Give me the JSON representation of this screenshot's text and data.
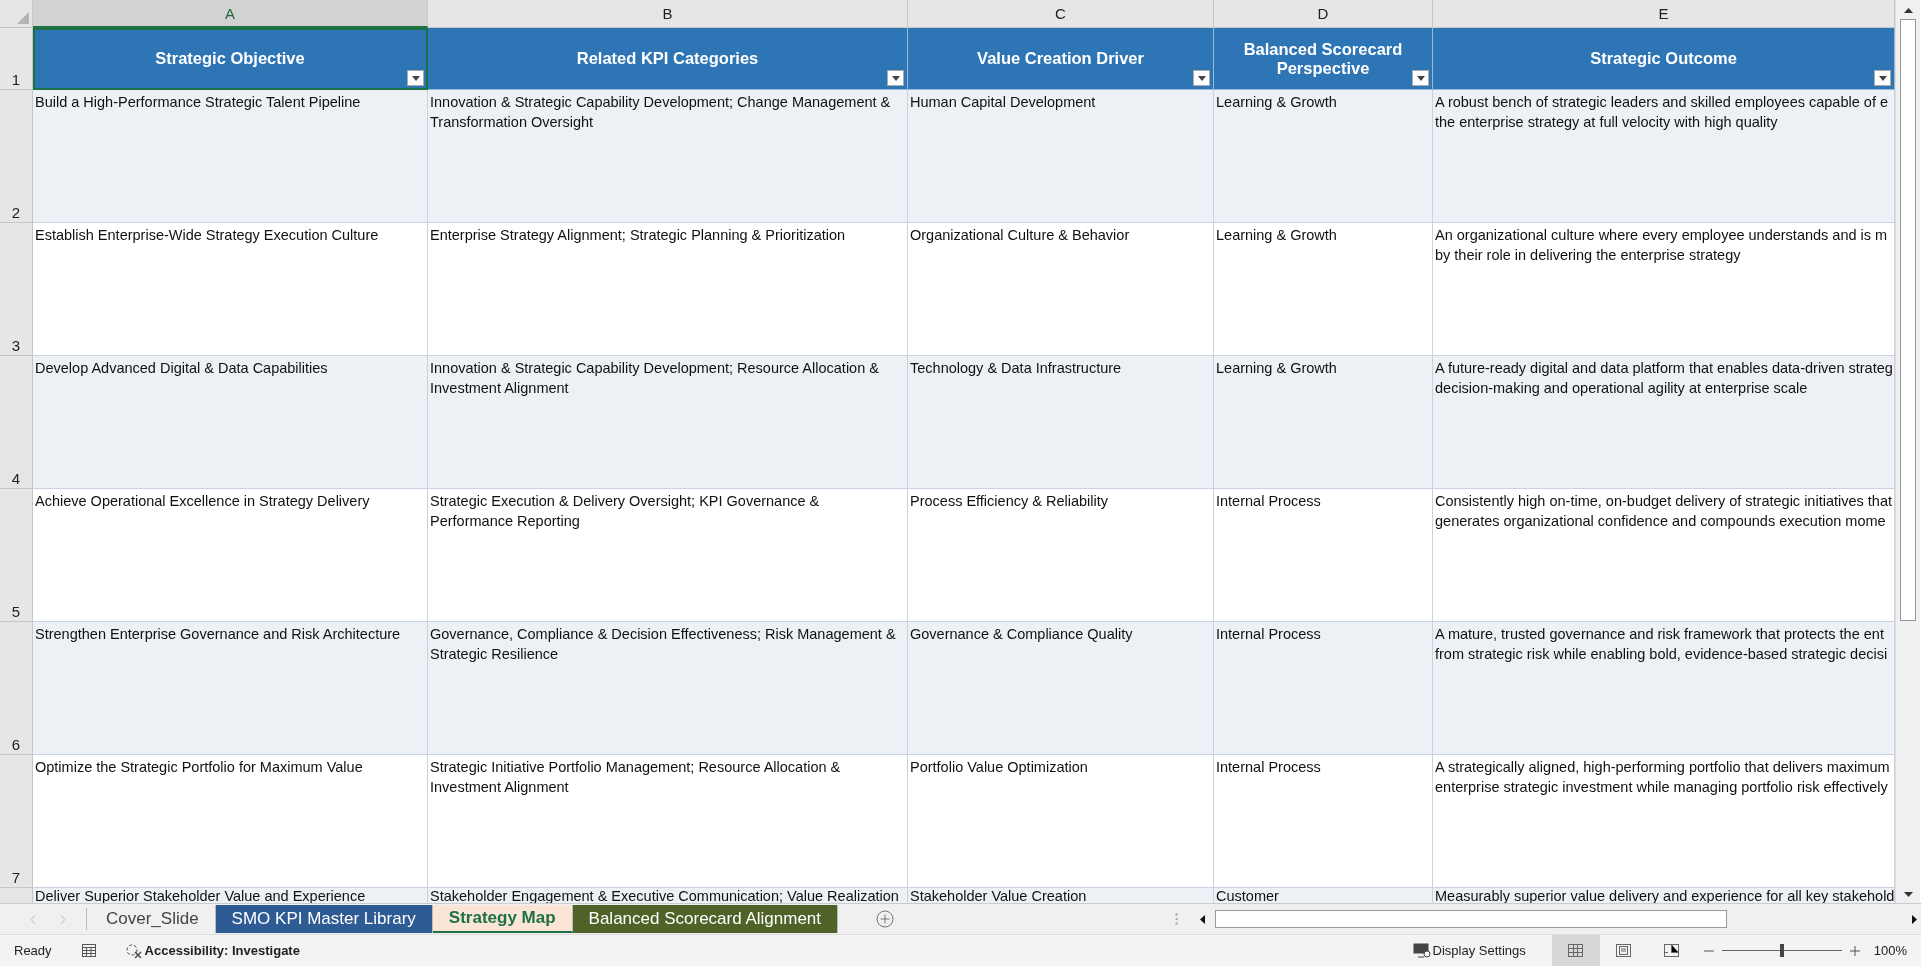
{
  "columns": [
    {
      "letter": "A",
      "header": "Strategic Objective",
      "selected": true
    },
    {
      "letter": "B",
      "header": "Related KPI Categories",
      "selected": false
    },
    {
      "letter": "C",
      "header": "Value Creation Driver",
      "selected": false
    },
    {
      "letter": "D",
      "header": "Balanced Scorecard Perspective",
      "selected": false
    },
    {
      "letter": "E",
      "header": "Strategic Outcome",
      "selected": false
    }
  ],
  "header_row_number": "1",
  "rows": [
    {
      "number": "2",
      "objective": "Build a High-Performance Strategic Talent Pipeline",
      "kpi_categories": "Innovation & Strategic Capability Development; Change Management & Transformation Oversight",
      "driver": "Human Capital Development",
      "perspective": "Learning & Growth",
      "outcome": [
        "A robust bench of strategic leaders and skilled employees capable of e",
        "the enterprise strategy at full velocity with high quality"
      ]
    },
    {
      "number": "3",
      "objective": "Establish Enterprise-Wide Strategy Execution Culture",
      "kpi_categories": "Enterprise Strategy Alignment; Strategic Planning & Prioritization",
      "driver": "Organizational Culture & Behavior",
      "perspective": "Learning & Growth",
      "outcome": [
        "An organizational culture where every employee understands and is m",
        "by their role in delivering the enterprise strategy"
      ]
    },
    {
      "number": "4",
      "objective": "Develop Advanced Digital & Data Capabilities",
      "kpi_categories": "Innovation & Strategic Capability Development; Resource Allocation & Investment Alignment",
      "driver": "Technology & Data Infrastructure",
      "perspective": "Learning & Growth",
      "outcome": [
        "A future-ready digital and data platform that enables data-driven strateg",
        "decision-making and operational agility at enterprise scale"
      ]
    },
    {
      "number": "5",
      "objective": "Achieve Operational Excellence in Strategy Delivery",
      "kpi_categories": "Strategic Execution & Delivery Oversight; KPI Governance & Performance Reporting",
      "driver": "Process Efficiency & Reliability",
      "perspective": "Internal Process",
      "outcome": [
        "Consistently high on-time, on-budget delivery of strategic initiatives that",
        "generates organizational confidence and compounds execution mome"
      ]
    },
    {
      "number": "6",
      "objective": "Strengthen Enterprise Governance and Risk Architecture",
      "kpi_categories": "Governance, Compliance & Decision Effectiveness; Risk Management & Strategic Resilience",
      "driver": "Governance & Compliance Quality",
      "perspective": "Internal Process",
      "outcome": [
        "A mature, trusted governance and risk framework that protects the ent",
        "from strategic risk while enabling bold, evidence-based strategic decisi"
      ]
    },
    {
      "number": "7",
      "objective": "Optimize the Strategic Portfolio for Maximum Value",
      "kpi_categories": "Strategic Initiative Portfolio Management; Resource Allocation & Investment Alignment",
      "driver": "Portfolio Value Optimization",
      "perspective": "Internal Process",
      "outcome": [
        "A strategically aligned, high-performing portfolio that delivers maximum",
        "enterprise strategic investment while managing portfolio risk effectively"
      ]
    },
    {
      "objective": "Deliver Superior Stakeholder Value and Experience",
      "kpi_categories": "Stakeholder Engagement & Executive Communication; Value Realization",
      "driver": "Stakeholder Value Creation",
      "perspective": "Customer",
      "outcome": [
        "Measurably superior value delivery and experience for all key stakehold"
      ]
    }
  ],
  "sheet_tabs": [
    {
      "label": "Cover_Slide",
      "selected": false
    },
    {
      "label": "SMO KPI Master Library",
      "selected": false,
      "color": "#2f5b94"
    },
    {
      "label": "Strategy Map",
      "selected": true,
      "color": "#fbe5d6"
    },
    {
      "label": "Balanced Scorecard Alignment",
      "selected": false,
      "color": "#4f6228"
    }
  ],
  "status_bar": {
    "mode": "Ready",
    "accessibility": "Accessibility: Investigate",
    "display_settings": "Display Settings",
    "views": [
      {
        "kind": "normal",
        "selected": true
      },
      {
        "kind": "page-layout",
        "selected": false
      },
      {
        "kind": "page-break",
        "selected": false
      }
    ],
    "zoom": {
      "level": 0.5,
      "reading": "100%"
    }
  }
}
